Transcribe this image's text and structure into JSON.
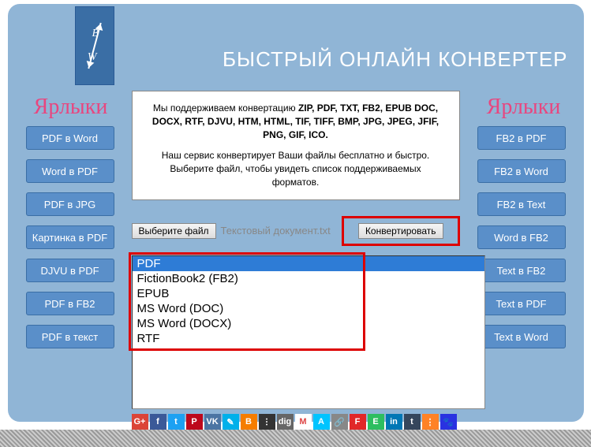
{
  "site_title": "БЫСТРЫЙ ОНЛАЙН КОНВЕРТЕР",
  "logo": {
    "top": "B",
    "bottom": "W"
  },
  "sidebar_left": {
    "title": "Ярлыки",
    "items": [
      "PDF в Word",
      "Word в PDF",
      "PDF в JPG",
      "Картинка в PDF",
      "DJVU в PDF",
      "PDF в FB2",
      "PDF в текст"
    ]
  },
  "sidebar_right": {
    "title": "Ярлыки",
    "items": [
      "FB2 в PDF",
      "FB2 в Word",
      "FB2 в Text",
      "Word в FB2",
      "Text в FB2",
      "Text в PDF",
      "Text в Word"
    ]
  },
  "info": {
    "line1_prefix": "Мы поддерживаем конвертацию ",
    "line1_bold": "ZIP, PDF, TXT, FB2, EPUB DOC, DOCX, RTF, DJVU, HTM, HTML, TIF, TIFF, BMP, JPG, JPEG, JFIF, PNG, GIF, ICO.",
    "line2": "Наш сервис конвертирует Ваши файлы бесплатно и быстро. Выберите файл, чтобы увидеть список поддерживаемых форматов."
  },
  "controls": {
    "choose_file": "Выберите файл",
    "filename": "Текстовый документ.txt",
    "convert": "Конвертировать"
  },
  "formats": [
    "PDF",
    "FictionBook2 (FB2)",
    "EPUB",
    "MS Word (DOC)",
    "MS Word (DOCX)",
    "RTF"
  ],
  "selected_format_index": 0,
  "social": [
    {
      "name": "google-plus-icon",
      "bg": "#db4437",
      "txt": "G+"
    },
    {
      "name": "facebook-icon",
      "bg": "#3b5998",
      "txt": "f"
    },
    {
      "name": "twitter-icon",
      "bg": "#1da1f2",
      "txt": "t"
    },
    {
      "name": "pinterest-icon",
      "bg": "#bd081c",
      "txt": "P"
    },
    {
      "name": "vk-icon",
      "bg": "#4c75a3",
      "txt": "VK"
    },
    {
      "name": "livejournal-icon",
      "bg": "#00b0ea",
      "txt": "✎"
    },
    {
      "name": "blogger-icon",
      "bg": "#f57d00",
      "txt": "B"
    },
    {
      "name": "myspace-icon",
      "bg": "#333",
      "txt": "ⵗ"
    },
    {
      "name": "digg-icon",
      "bg": "#666",
      "txt": "dig"
    },
    {
      "name": "gmail-icon",
      "bg": "#fff",
      "txt": "M",
      "fg": "#d44"
    },
    {
      "name": "aol-icon",
      "bg": "#00c4ff",
      "txt": "A"
    },
    {
      "name": "link-icon",
      "bg": "#888",
      "txt": "🔗"
    },
    {
      "name": "flipboard-icon",
      "bg": "#e12828",
      "txt": "F"
    },
    {
      "name": "evernote-icon",
      "bg": "#2dbe60",
      "txt": "E"
    },
    {
      "name": "linkedin-icon",
      "bg": "#0077b5",
      "txt": "in"
    },
    {
      "name": "tumblr-icon",
      "bg": "#35465c",
      "txt": "t"
    },
    {
      "name": "mix-icon",
      "bg": "#ff8226",
      "txt": "⋮"
    },
    {
      "name": "baidu-icon",
      "bg": "#2932e1",
      "txt": "🐾"
    }
  ]
}
